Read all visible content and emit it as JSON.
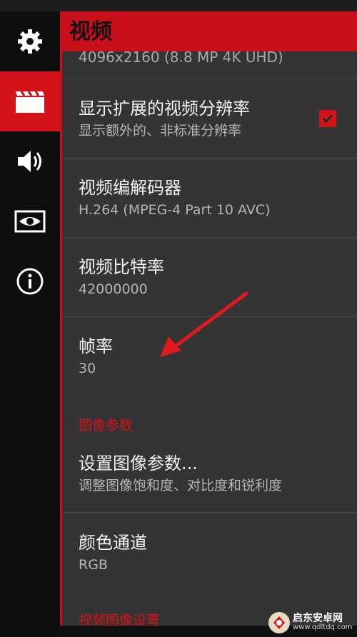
{
  "header": {
    "title": "视频"
  },
  "sidebar": {
    "items": [
      {
        "icon": "gear-icon",
        "active": false
      },
      {
        "icon": "video-icon",
        "active": true
      },
      {
        "icon": "speaker-icon",
        "active": false
      },
      {
        "icon": "eye-icon",
        "active": false
      },
      {
        "icon": "info-icon",
        "active": false
      }
    ]
  },
  "settings": {
    "partial_top": "4096x2160 (8.8 MP 4K UHD)",
    "extended_resolution": {
      "title": "显示扩展的视频分辨率",
      "summary": "显示额外的、非标准分辨率",
      "checked": true
    },
    "codec": {
      "title": "视频编解码器",
      "summary": "H.264 (MPEG-4 Part 10 AVC)"
    },
    "bitrate": {
      "title": "视频比特率",
      "summary": "42000000"
    },
    "framerate": {
      "title": "帧率",
      "summary": "30"
    },
    "image_category": "图像参数",
    "image_params": {
      "title": "设置图像参数...",
      "summary": "调整图像饱和度、对比度和锐利度"
    },
    "color_channel": {
      "title": "颜色通道",
      "summary": "RGB"
    },
    "bottom_category": "视频图像设置"
  },
  "watermark": {
    "brand": "启东安卓网",
    "url": "www.qdltdq.com"
  },
  "colors": {
    "accent": "#d4121a",
    "panel": "#343434",
    "sidebar": "#0d0d0d"
  }
}
